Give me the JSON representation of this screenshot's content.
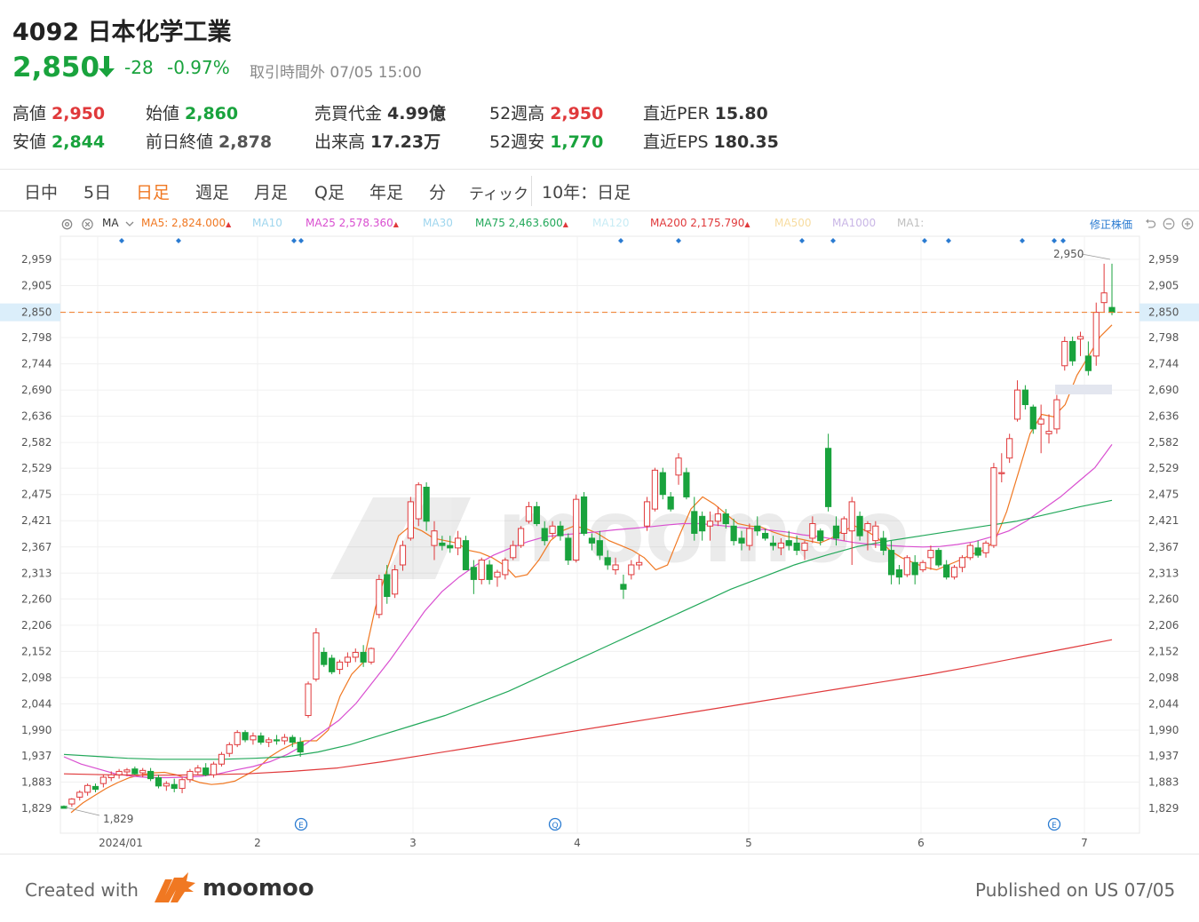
{
  "header": {
    "title": "4092 日本化学工業",
    "price": "2,850",
    "change": "-28",
    "change_pct": "-0.97%",
    "status": "取引時間外 07/05 15:00"
  },
  "stats": [
    {
      "label": "高値",
      "value": "2,950",
      "color": "red"
    },
    {
      "label": "安値",
      "value": "2,844",
      "color": "green"
    },
    {
      "label": "始値",
      "value": "2,860",
      "color": "green"
    },
    {
      "label": "前日終値",
      "value": "2,878",
      "color": "dark"
    },
    {
      "label": "売買代金",
      "value": "4.99億",
      "color": "dark"
    },
    {
      "label": "出来高",
      "value": "17.23万",
      "color": "dark"
    },
    {
      "label": "52週高",
      "value": "2,950",
      "color": "red"
    },
    {
      "label": "52週安",
      "value": "1,770",
      "color": "green"
    },
    {
      "label": "直近PER",
      "value": "15.80",
      "color": "dark"
    },
    {
      "label": "直近EPS",
      "value": "180.35",
      "color": "dark"
    }
  ],
  "tabs": [
    {
      "label": "日中",
      "active": false
    },
    {
      "label": "5日",
      "active": false
    },
    {
      "label": "日足",
      "active": true
    },
    {
      "label": "週足",
      "active": false
    },
    {
      "label": "月足",
      "active": false
    },
    {
      "label": "Q足",
      "active": false
    },
    {
      "label": "年足",
      "active": false
    },
    {
      "label": "分",
      "active": false
    },
    {
      "label": "ティック",
      "active": false
    },
    {
      "label": "10年：日足",
      "active": false
    }
  ],
  "ma_legend": {
    "prefix": "MA",
    "items": [
      {
        "label": "MA5: 2,824.000",
        "color": "#f07822"
      },
      {
        "label": "MA10",
        "color": "#9fd6ee"
      },
      {
        "label": "MA25  2,578.360",
        "color": "#d94fd0"
      },
      {
        "label": "MA30",
        "color": "#9fd6ee"
      },
      {
        "label": "MA75  2,463.600",
        "color": "#22a85a"
      },
      {
        "label": "MA120",
        "color": "#c8ecf5"
      },
      {
        "label": "MA200  2,175.790",
        "color": "#e0393b"
      },
      {
        "label": "MA500",
        "color": "#f7dca0"
      },
      {
        "label": "MA1000",
        "color": "#c9b6e6"
      },
      {
        "label": "MA1:",
        "color": "#c0c0c0"
      }
    ],
    "adjust_label": "修正株価"
  },
  "chart_data": {
    "type": "candlestick",
    "y_ticks": [
      "2,959",
      "2,905",
      "2,850",
      "2,798",
      "2,744",
      "2,690",
      "2,636",
      "2,582",
      "2,529",
      "2,475",
      "2,421",
      "2,367",
      "2,313",
      "2,260",
      "2,206",
      "2,152",
      "2,098",
      "2,044",
      "1,990",
      "1,937",
      "1,883",
      "1,829"
    ],
    "ylim": [
      1800,
      2990
    ],
    "current_price_label": "2,850",
    "current_price": 2850,
    "x_labels": [
      "2024/01",
      "2",
      "3",
      "4",
      "5",
      "6",
      "7"
    ],
    "high_label": "2,950",
    "low_label": "1,829",
    "event_markers": [
      "E",
      "Q",
      "E"
    ],
    "watermark": "moomoo",
    "candles": [
      [
        1833,
        1835,
        1828,
        1829
      ],
      [
        1838,
        1850,
        1832,
        1848
      ],
      [
        1852,
        1866,
        1845,
        1862
      ],
      [
        1862,
        1880,
        1855,
        1876
      ],
      [
        1874,
        1880,
        1862,
        1868
      ],
      [
        1880,
        1898,
        1872,
        1893
      ],
      [
        1892,
        1905,
        1885,
        1898
      ],
      [
        1898,
        1910,
        1890,
        1905
      ],
      [
        1904,
        1912,
        1895,
        1908
      ],
      [
        1910,
        1915,
        1898,
        1900
      ],
      [
        1902,
        1912,
        1893,
        1907
      ],
      [
        1905,
        1912,
        1885,
        1890
      ],
      [
        1892,
        1898,
        1870,
        1875
      ],
      [
        1875,
        1885,
        1865,
        1880
      ],
      [
        1878,
        1890,
        1862,
        1870
      ],
      [
        1870,
        1892,
        1860,
        1888
      ],
      [
        1888,
        1910,
        1882,
        1905
      ],
      [
        1904,
        1918,
        1898,
        1912
      ],
      [
        1912,
        1922,
        1895,
        1898
      ],
      [
        1898,
        1925,
        1892,
        1920
      ],
      [
        1920,
        1945,
        1915,
        1940
      ],
      [
        1942,
        1965,
        1935,
        1960
      ],
      [
        1960,
        1990,
        1955,
        1985
      ],
      [
        1985,
        1990,
        1965,
        1970
      ],
      [
        1970,
        1985,
        1960,
        1978
      ],
      [
        1978,
        1985,
        1960,
        1965
      ],
      [
        1965,
        1975,
        1955,
        1970
      ],
      [
        1970,
        1980,
        1960,
        1968
      ],
      [
        1968,
        1982,
        1960,
        1975
      ],
      [
        1975,
        1980,
        1955,
        1965
      ],
      [
        1965,
        1975,
        1935,
        1945
      ],
      [
        2020,
        2090,
        2015,
        2085
      ],
      [
        2095,
        2200,
        2090,
        2190
      ],
      [
        2150,
        2160,
        2120,
        2125
      ],
      [
        2138,
        2145,
        2105,
        2110
      ],
      [
        2115,
        2135,
        2105,
        2130
      ],
      [
        2130,
        2150,
        2120,
        2140
      ],
      [
        2140,
        2158,
        2130,
        2150
      ],
      [
        2150,
        2165,
        2120,
        2130
      ],
      [
        2130,
        2160,
        2125,
        2158
      ],
      [
        2228,
        2310,
        2220,
        2300
      ],
      [
        2310,
        2330,
        2250,
        2265
      ],
      [
        2270,
        2330,
        2262,
        2320
      ],
      [
        2330,
        2380,
        2318,
        2370
      ],
      [
        2385,
        2470,
        2380,
        2460
      ],
      [
        2425,
        2500,
        2410,
        2495
      ],
      [
        2490,
        2500,
        2400,
        2420
      ],
      [
        2370,
        2420,
        2340,
        2400
      ],
      [
        2375,
        2390,
        2360,
        2370
      ],
      [
        2370,
        2390,
        2355,
        2365
      ],
      [
        2365,
        2400,
        2350,
        2385
      ],
      [
        2380,
        2390,
        2320,
        2320
      ],
      [
        2325,
        2340,
        2270,
        2300
      ],
      [
        2300,
        2345,
        2290,
        2340
      ],
      [
        2330,
        2340,
        2290,
        2300
      ],
      [
        2305,
        2320,
        2285,
        2315
      ],
      [
        2310,
        2345,
        2300,
        2340
      ],
      [
        2345,
        2380,
        2340,
        2370
      ],
      [
        2370,
        2410,
        2365,
        2405
      ],
      [
        2420,
        2460,
        2415,
        2450
      ],
      [
        2450,
        2460,
        2410,
        2415
      ],
      [
        2405,
        2420,
        2370,
        2380
      ],
      [
        2395,
        2420,
        2385,
        2410
      ],
      [
        2410,
        2420,
        2380,
        2390
      ],
      [
        2385,
        2395,
        2330,
        2340
      ],
      [
        2340,
        2475,
        2335,
        2465
      ],
      [
        2470,
        2480,
        2390,
        2395
      ],
      [
        2385,
        2395,
        2360,
        2375
      ],
      [
        2380,
        2400,
        2340,
        2350
      ],
      [
        2345,
        2360,
        2320,
        2330
      ],
      [
        2320,
        2345,
        2310,
        2330
      ],
      [
        2290,
        2310,
        2260,
        2280
      ],
      [
        2310,
        2340,
        2300,
        2330
      ],
      [
        2330,
        2350,
        2320,
        2335
      ],
      [
        2410,
        2470,
        2400,
        2460
      ],
      [
        2445,
        2530,
        2440,
        2525
      ],
      [
        2520,
        2530,
        2465,
        2475
      ],
      [
        2470,
        2480,
        2440,
        2445
      ],
      [
        2515,
        2560,
        2495,
        2550
      ],
      [
        2520,
        2530,
        2465,
        2470
      ],
      [
        2440,
        2470,
        2380,
        2395
      ],
      [
        2430,
        2440,
        2380,
        2400
      ],
      [
        2410,
        2440,
        2380,
        2420
      ],
      [
        2420,
        2450,
        2410,
        2435
      ],
      [
        2435,
        2445,
        2405,
        2415
      ],
      [
        2410,
        2425,
        2370,
        2380
      ],
      [
        2385,
        2400,
        2360,
        2375
      ],
      [
        2370,
        2415,
        2360,
        2405
      ],
      [
        2410,
        2430,
        2390,
        2400
      ],
      [
        2395,
        2405,
        2380,
        2385
      ],
      [
        2375,
        2390,
        2360,
        2370
      ],
      [
        2365,
        2385,
        2350,
        2375
      ],
      [
        2380,
        2400,
        2360,
        2370
      ],
      [
        2375,
        2390,
        2350,
        2360
      ],
      [
        2360,
        2380,
        2340,
        2375
      ],
      [
        2385,
        2430,
        2375,
        2415
      ],
      [
        2400,
        2405,
        2370,
        2380
      ],
      [
        2570,
        2600,
        2440,
        2450
      ],
      [
        2410,
        2430,
        2370,
        2385
      ],
      [
        2395,
        2430,
        2380,
        2425
      ],
      [
        2400,
        2470,
        2330,
        2460
      ],
      [
        2430,
        2440,
        2380,
        2390
      ],
      [
        2400,
        2420,
        2360,
        2415
      ],
      [
        2380,
        2420,
        2365,
        2410
      ],
      [
        2385,
        2400,
        2350,
        2360
      ],
      [
        2360,
        2380,
        2290,
        2310
      ],
      [
        2320,
        2330,
        2290,
        2305
      ],
      [
        2310,
        2350,
        2305,
        2345
      ],
      [
        2335,
        2350,
        2290,
        2310
      ],
      [
        2320,
        2340,
        2315,
        2335
      ],
      [
        2345,
        2370,
        2320,
        2360
      ],
      [
        2360,
        2365,
        2325,
        2330
      ],
      [
        2330,
        2340,
        2300,
        2305
      ],
      [
        2305,
        2330,
        2300,
        2325
      ],
      [
        2325,
        2350,
        2315,
        2345
      ],
      [
        2345,
        2375,
        2340,
        2370
      ],
      [
        2365,
        2380,
        2345,
        2350
      ],
      [
        2355,
        2380,
        2345,
        2375
      ],
      [
        2370,
        2540,
        2365,
        2530
      ],
      [
        2520,
        2560,
        2500,
        2520
      ],
      [
        2550,
        2600,
        2540,
        2590
      ],
      [
        2630,
        2710,
        2625,
        2690
      ],
      [
        2690,
        2700,
        2650,
        2660
      ],
      [
        2655,
        2660,
        2600,
        2610
      ],
      [
        2620,
        2660,
        2560,
        2630
      ],
      [
        2600,
        2640,
        2580,
        2605
      ],
      [
        2610,
        2680,
        2600,
        2670
      ],
      [
        2740,
        2800,
        2730,
        2790
      ],
      [
        2790,
        2800,
        2740,
        2750
      ],
      [
        2795,
        2810,
        2760,
        2800
      ],
      [
        2760,
        2790,
        2720,
        2730
      ],
      [
        2760,
        2870,
        2740,
        2850
      ],
      [
        2870,
        2950,
        2850,
        2890
      ],
      [
        2860,
        2950,
        2844,
        2850
      ]
    ],
    "series": [
      {
        "name": "MA5",
        "color": "#f07822",
        "values": [
          1820,
          1840,
          1855,
          1870,
          1882,
          1892,
          1898,
          1902,
          1903,
          1898,
          1890,
          1882,
          1878,
          1880,
          1885,
          1898,
          1912,
          1935,
          1950,
          1962,
          1968,
          1968,
          1990,
          2060,
          2105,
          2130,
          2240,
          2320,
          2390,
          2410,
          2400,
          2385,
          2380,
          2375,
          2360,
          2355,
          2345,
          2330,
          2305,
          2310,
          2340,
          2380,
          2400,
          2410,
          2405,
          2395,
          2380,
          2370,
          2360,
          2345,
          2320,
          2330,
          2390,
          2445,
          2470,
          2455,
          2435,
          2415,
          2410,
          2408,
          2398,
          2390,
          2385,
          2380,
          2375,
          2385,
          2400,
          2410,
          2400,
          2385,
          2360,
          2345,
          2335,
          2325,
          2320,
          2330,
          2340,
          2352,
          2360,
          2380,
          2440,
          2520,
          2600,
          2640,
          2635,
          2660,
          2720,
          2760,
          2800,
          2824
        ]
      },
      {
        "name": "MA25",
        "color": "#d94fd0",
        "values": [
          1935,
          1920,
          1910,
          1900,
          1895,
          1892,
          1892,
          1893,
          1895,
          1900,
          1908,
          1915,
          1925,
          1940,
          1960,
          1985,
          2010,
          2045,
          2090,
          2135,
          2185,
          2235,
          2275,
          2305,
          2330,
          2350,
          2365,
          2378,
          2388,
          2392,
          2395,
          2398,
          2402,
          2405,
          2408,
          2412,
          2415,
          2415,
          2412,
          2408,
          2405,
          2402,
          2398,
          2392,
          2388,
          2382,
          2376,
          2372,
          2370,
          2368,
          2367,
          2368,
          2372,
          2378,
          2388,
          2400,
          2420,
          2445,
          2470,
          2500,
          2530,
          2578
        ]
      },
      {
        "name": "MA75",
        "color": "#22a85a",
        "values": [
          1940,
          1936,
          1932,
          1930,
          1930,
          1930,
          1932,
          1935,
          1945,
          1960,
          1980,
          2000,
          2020,
          2045,
          2070,
          2100,
          2130,
          2160,
          2190,
          2220,
          2250,
          2280,
          2305,
          2330,
          2350,
          2368,
          2380,
          2390,
          2400,
          2410,
          2420,
          2435,
          2450,
          2463
        ]
      },
      {
        "name": "MA200",
        "color": "#e0393b",
        "values": [
          1900,
          1898,
          1897,
          1898,
          1900,
          1905,
          1912,
          1925,
          1940,
          1955,
          1970,
          1985,
          2000,
          2015,
          2030,
          2045,
          2060,
          2075,
          2090,
          2105,
          2122,
          2140,
          2158,
          2176
        ]
      }
    ]
  },
  "footer": {
    "created_with": "Created with",
    "logo_text": "moomoo",
    "published": "Published on US 07/05"
  }
}
